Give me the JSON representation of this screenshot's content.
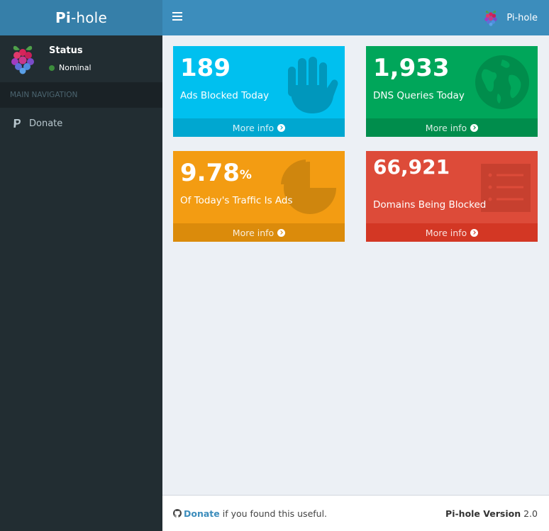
{
  "logo": {
    "bold": "Pi",
    "light": "-hole"
  },
  "user_panel": {
    "title": "Status",
    "status": "Nominal",
    "status_color": "#3c8c3c"
  },
  "nav": {
    "header": "MAIN NAVIGATION",
    "items": [
      {
        "label": "Donate",
        "icon": "paypal-icon"
      }
    ]
  },
  "header": {
    "user_name": "Pi-hole",
    "toggle_icon": "bars-icon"
  },
  "boxes": [
    {
      "value": "189",
      "label": "Ads Blocked Today",
      "more": "More info",
      "color": "#00c0ef",
      "icon": "hand-icon"
    },
    {
      "value": "1,933",
      "label": "DNS Queries Today",
      "more": "More info",
      "color": "#00a65a",
      "icon": "globe-icon"
    },
    {
      "value": "9.78",
      "unit": "%",
      "label": "Of Today's Traffic Is Ads",
      "more": "More info",
      "color": "#f39c12",
      "icon": "pie-chart-icon"
    },
    {
      "value": "66,921",
      "label": "Domains Being Blocked",
      "more": "More info",
      "color": "#dd4b39",
      "icon": "list-alt-icon"
    }
  ],
  "footer": {
    "donate": "Donate",
    "donate_suffix": "if you found this useful.",
    "version_label": "Pi-hole Version",
    "version": "2.0"
  }
}
